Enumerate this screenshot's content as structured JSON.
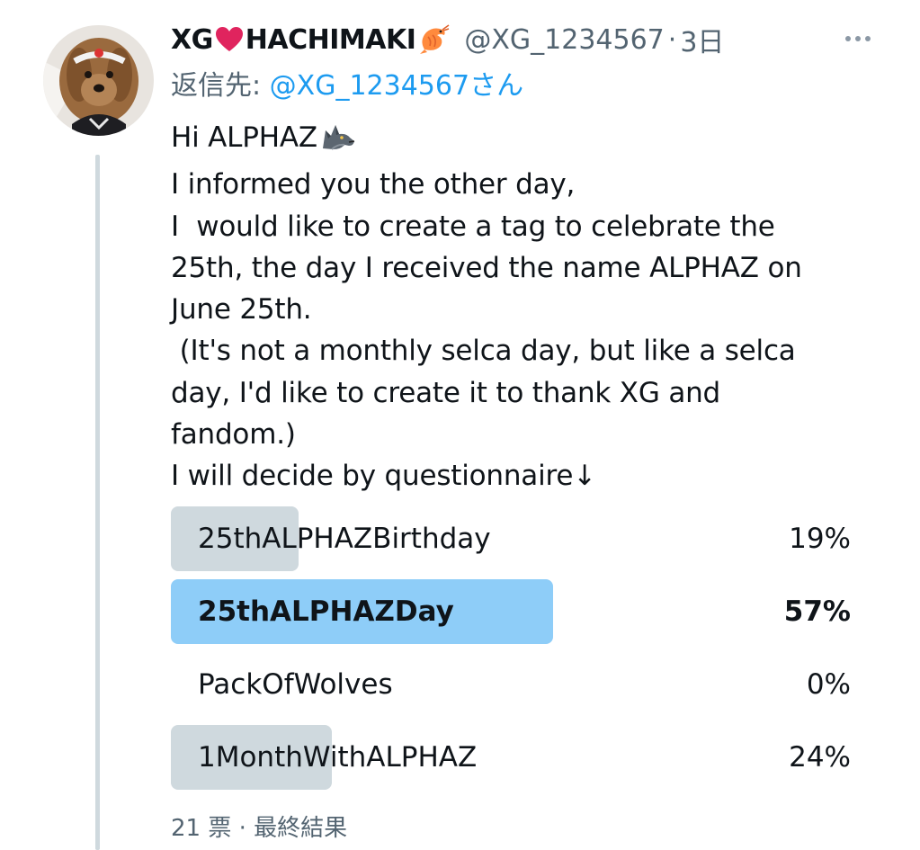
{
  "tweet": {
    "author": {
      "name_part1": "XG",
      "name_part2": "HACHIMAKI",
      "name_icons": [
        "heart-icon",
        "shrimp-icon"
      ],
      "handle": "@XG_1234567",
      "separator": "·",
      "time": "3日"
    },
    "reply_to": {
      "prefix": "返信先: ",
      "handle": "@XG_1234567さん"
    },
    "text_lines": [
      "Hi ALPHAZ",
      "I informed you the other day,",
      "I  would like to create a tag to celebrate the",
      "25th, the day I received the name ALPHAZ on",
      "June 25th.",
      " (It's not a monthly selca day, but like a selca",
      "day, I'd like to create it to thank XG and",
      "fandom.)",
      "I will decide by questionnaire↓"
    ],
    "text_icons": [
      "wolf-icon"
    ],
    "poll": {
      "options": [
        {
          "label": "25thALPHAZBirthday",
          "percent_text": "19%",
          "fill": 0.19,
          "winner": false
        },
        {
          "label": "25thALPHAZDay",
          "percent_text": "57%",
          "fill": 0.57,
          "winner": true
        },
        {
          "label": "PackOfWolves",
          "percent_text": "0%",
          "fill": 0.0,
          "winner": false
        },
        {
          "label": "1MonthWithALPHAZ",
          "percent_text": "24%",
          "fill": 0.24,
          "winner": false
        }
      ],
      "footer": "21 票 · 最終結果"
    }
  },
  "colors": {
    "text": "#0f1419",
    "secondary": "#536471",
    "link": "#1d9bf0",
    "poll_bar": "#cfd9de",
    "poll_winner": "#8ecdf8"
  }
}
